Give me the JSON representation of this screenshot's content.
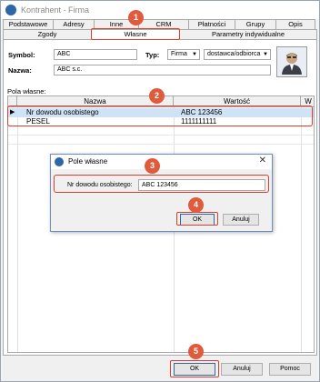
{
  "window": {
    "title": "Kontrahent - Firma"
  },
  "tabs_row1": [
    "Podstawowe",
    "Adresy",
    "Inne",
    "CRM",
    "Płatności",
    "Grupy",
    "Opis"
  ],
  "tabs_row2": [
    "Zgody",
    "Własne",
    "Parametry indywidualne"
  ],
  "active_tab": "Własne",
  "header": {
    "symbol_label": "Symbol:",
    "symbol_value": "ABC",
    "typ_label": "Typ:",
    "typ_value": "Firma",
    "role_value": "dostawca/odbiorca",
    "nazwa_label": "Nazwa:",
    "nazwa_value": "ABC s.c."
  },
  "grid": {
    "label": "Pola własne:",
    "columns": [
      "Nazwa",
      "Wartość",
      "W"
    ],
    "rows": [
      {
        "marker": "▶",
        "name": "Nr dowodu osobistego",
        "value": "ABC 123456"
      },
      {
        "marker": "",
        "name": "PESEL",
        "value": "1111111111"
      }
    ]
  },
  "dialog": {
    "title": "Pole własne",
    "field_label": "Nr dowodu osobistego:",
    "field_value": "ABC 123456",
    "ok_label": "OK",
    "cancel_label": "Anuluj"
  },
  "footer": {
    "ok_label": "OK",
    "cancel_label": "Anuluj",
    "help_label": "Pomoc"
  },
  "badges": [
    "1",
    "2",
    "3",
    "4",
    "5"
  ],
  "colors": {
    "highlight": "#e03c2b",
    "badge": "#e05a3c",
    "selected_row": "#cfe3f7"
  }
}
